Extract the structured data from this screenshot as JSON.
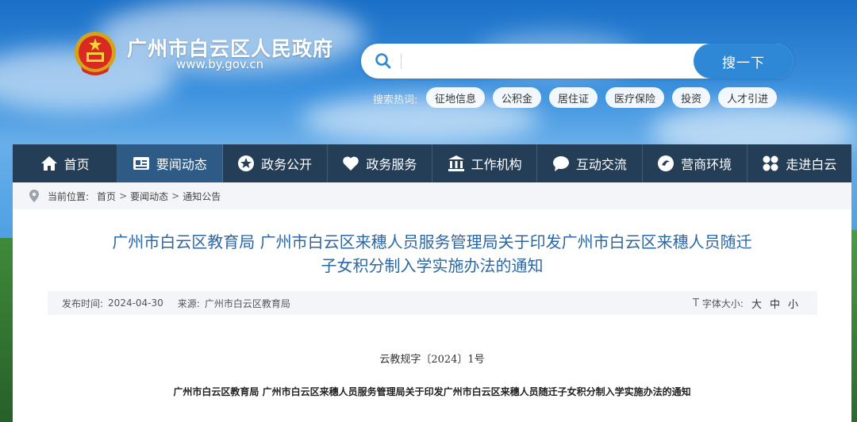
{
  "header": {
    "site_name": "广州市白云区人民政府",
    "site_url": "www.by.gov.cn",
    "emblem_icon": "national-emblem-icon"
  },
  "search": {
    "placeholder": "",
    "value": "",
    "button_label": "搜一下",
    "hot_label": "搜索热词:",
    "hot_tags": [
      "征地信息",
      "公积金",
      "居住证",
      "医疗保险",
      "投资",
      "人才引进"
    ]
  },
  "nav": {
    "items": [
      {
        "label": "首页",
        "icon": "home-icon"
      },
      {
        "label": "要闻动态",
        "icon": "news-icon"
      },
      {
        "label": "政务公开",
        "icon": "star-badge-icon"
      },
      {
        "label": "政务服务",
        "icon": "heart-icon"
      },
      {
        "label": "工作机构",
        "icon": "building-icon"
      },
      {
        "label": "互动交流",
        "icon": "chat-icon"
      },
      {
        "label": "营商环境",
        "icon": "swirl-icon"
      },
      {
        "label": "走进白云",
        "icon": "grid-icon"
      }
    ],
    "active_index": 1
  },
  "breadcrumb": {
    "prefix": "当前位置:",
    "items": [
      "首页",
      "要闻动态",
      "通知公告"
    ],
    "separator": ">"
  },
  "article": {
    "title_line1": "广州市白云区教育局 广州市白云区来穗人员服务管理局关于印发广州市白云区来穗人员随迁",
    "title_line2": "子女积分制入学实施办法的通知",
    "publish_label": "发布时间:",
    "publish_date": "2024-04-30",
    "source_label": "来源:",
    "source": "广州市白云区教育局",
    "font_size_label": "字体大小:",
    "font_sizes": [
      "大",
      "中",
      "小"
    ],
    "doc_number": "云教规字〔2024〕1号",
    "doc_title": "广州市白云区教育局 广州市白云区来穗人员服务管理局关于印发广州市白云区来穗人员随迁子女积分制入学实施办法的通知"
  },
  "colors": {
    "nav_bg": "#253e57",
    "nav_active": "#2e5b86",
    "title_blue": "#2b67a6",
    "search_button": "#2f88d6"
  }
}
